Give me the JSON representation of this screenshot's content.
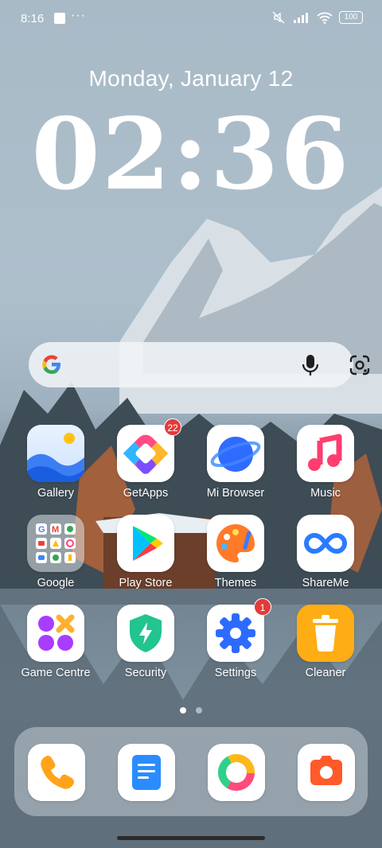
{
  "status_bar": {
    "time": "8:16",
    "more": "···",
    "battery": "100"
  },
  "lockscreen": {
    "date": "Monday, January 12",
    "clock": "02:36"
  },
  "search": {
    "icons": [
      "google-logo",
      "mic-icon",
      "lens-icon"
    ]
  },
  "apps": [
    {
      "label": "Gallery",
      "icon": "gallery-icon"
    },
    {
      "label": "GetApps",
      "icon": "getapps-icon",
      "badge": "22"
    },
    {
      "label": "Mi Browser",
      "icon": "browser-icon"
    },
    {
      "label": "Music",
      "icon": "music-icon"
    },
    {
      "label": "Google",
      "icon": "google-folder-icon"
    },
    {
      "label": "Play Store",
      "icon": "play-store-icon"
    },
    {
      "label": "Themes",
      "icon": "themes-icon"
    },
    {
      "label": "ShareMe",
      "icon": "shareme-icon"
    },
    {
      "label": "Game Centre",
      "icon": "game-centre-icon"
    },
    {
      "label": "Security",
      "icon": "security-icon"
    },
    {
      "label": "Settings",
      "icon": "settings-icon",
      "badge": "1"
    },
    {
      "label": "Cleaner",
      "icon": "cleaner-icon"
    }
  ],
  "pager": {
    "pages": 2,
    "current": 1
  },
  "dock": [
    "phone-icon",
    "notes-icon",
    "camera-app-icon-ring",
    "camera-icon"
  ]
}
